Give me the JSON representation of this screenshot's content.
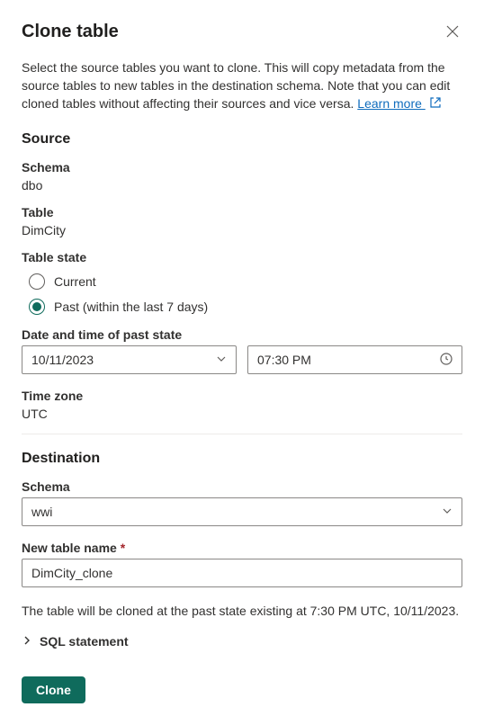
{
  "header": {
    "title": "Clone table"
  },
  "description": {
    "text_before_link": "Select the source tables you want to clone. This will copy metadata from the source tables to new tables in the destination schema. Note that you can edit cloned tables without affecting their sources and vice versa. ",
    "link_text": "Learn more "
  },
  "source": {
    "heading": "Source",
    "schema_label": "Schema",
    "schema_value": "dbo",
    "table_label": "Table",
    "table_value": "DimCity",
    "table_state_label": "Table state",
    "radio_current": "Current",
    "radio_past": "Past (within the last 7 days)",
    "datetime_label": "Date and time of past state",
    "date_value": "10/11/2023",
    "time_value": "07:30 PM",
    "timezone_label": "Time zone",
    "timezone_value": "UTC"
  },
  "destination": {
    "heading": "Destination",
    "schema_label": "Schema",
    "schema_value": "wwi",
    "name_label": "New table name ",
    "name_value": "DimCity_clone"
  },
  "hint": "The table will be cloned at the past state existing at 7:30 PM UTC, 10/11/2023.",
  "expander_label": "SQL statement",
  "footer": {
    "clone_label": "Clone"
  }
}
